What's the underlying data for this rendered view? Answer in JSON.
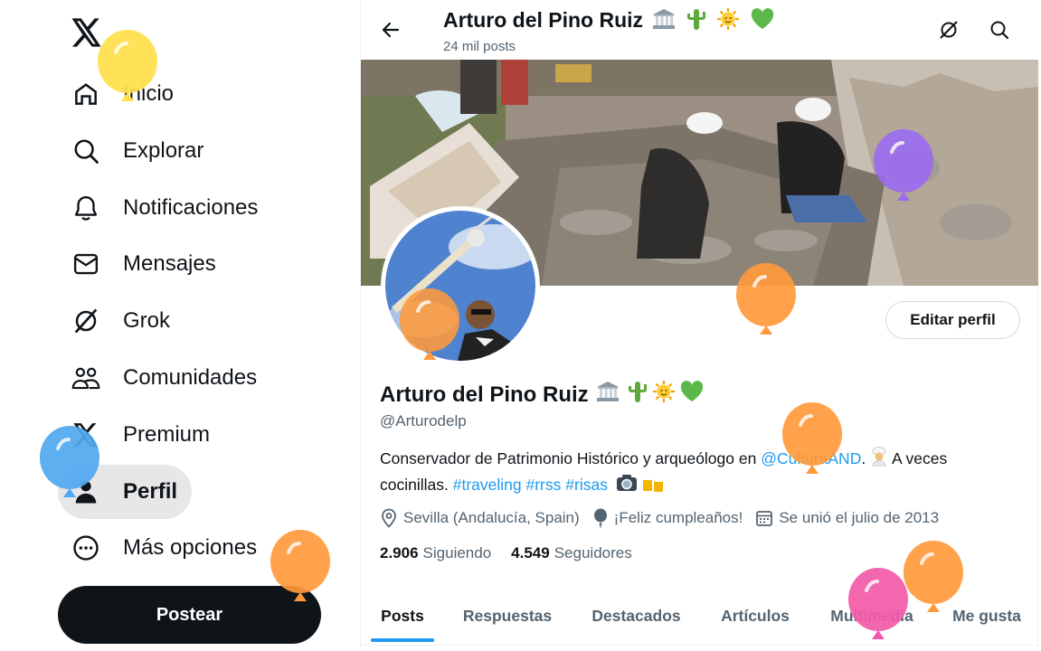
{
  "nav": {
    "items": [
      {
        "label": "Inicio",
        "icon": "home-icon"
      },
      {
        "label": "Explorar",
        "icon": "search-icon"
      },
      {
        "label": "Notificaciones",
        "icon": "bell-icon"
      },
      {
        "label": "Mensajes",
        "icon": "mail-icon"
      },
      {
        "label": "Grok",
        "icon": "grok-icon"
      },
      {
        "label": "Comunidades",
        "icon": "communities-icon"
      },
      {
        "label": "Premium",
        "icon": "x-logo-icon"
      },
      {
        "label": "Perfil",
        "icon": "person-icon",
        "active": true
      },
      {
        "label": "Más opciones",
        "icon": "more-circle-icon"
      }
    ],
    "post_label": "Postear"
  },
  "header": {
    "title": "Arturo del Pino Ruiz",
    "post_count": "24 mil posts"
  },
  "profile": {
    "name": "Arturo del Pino Ruiz",
    "handle": "@Arturodelp",
    "edit_label": "Editar perfil",
    "bio": {
      "part1": "Conservador de Patrimonio Histórico y arqueólogo en ",
      "mention": "@CulturaAND",
      "part2": ". ",
      "part3": " A veces cocinillas. ",
      "hashtags": [
        "#traveling",
        "#rrss",
        "#risas"
      ]
    },
    "location": "Sevilla (Andalucía, Spain)",
    "birthday": "¡Feliz cumpleaños!",
    "joined": "Se unió el julio de 2013",
    "following_count": "2.906",
    "following_label": "Siguiendo",
    "followers_count": "4.549",
    "followers_label": "Seguidores"
  },
  "tabs": [
    {
      "label": "Posts",
      "active": true
    },
    {
      "label": "Respuestas"
    },
    {
      "label": "Destacados"
    },
    {
      "label": "Artículos"
    },
    {
      "label": "Multimedia"
    },
    {
      "label": "Me gusta"
    }
  ],
  "colors": {
    "accent": "#1d9bf0",
    "text": "#0f1419",
    "muted": "#536471",
    "post_button": "#0f1419",
    "balloon_yellow": "#ffe04a",
    "balloon_orange": "#ff9a3c",
    "balloon_blue": "#4fa8ef",
    "balloon_purple": "#9a6cf0",
    "balloon_pink": "#f25aa8"
  }
}
